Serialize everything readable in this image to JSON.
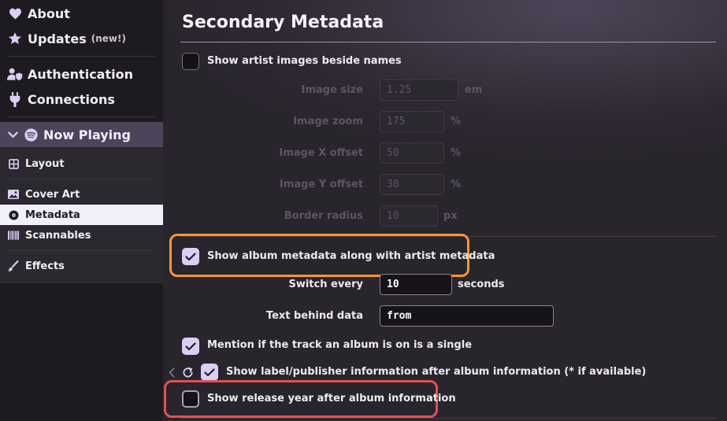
{
  "sidebar": {
    "about": "About",
    "updates": "Updates",
    "updates_badge": "(new!)",
    "authentication": "Authentication",
    "connections": "Connections",
    "now_playing": "Now Playing",
    "layout": "Layout",
    "cover_art": "Cover Art",
    "metadata": "Metadata",
    "scannables": "Scannables",
    "effects": "Effects",
    "selected": "Metadata"
  },
  "section": {
    "title": "Secondary Metadata"
  },
  "options": {
    "show_artist_images": {
      "label": "Show artist images beside names",
      "checked": false
    },
    "image_size": {
      "label": "Image size",
      "value": "1.25",
      "unit": "em"
    },
    "image_zoom": {
      "label": "Image zoom",
      "value": "175",
      "unit": "%"
    },
    "image_x_offset": {
      "label": "Image X offset",
      "value": "50",
      "unit": "%"
    },
    "image_y_offset": {
      "label": "Image Y offset",
      "value": "30",
      "unit": "%"
    },
    "border_radius": {
      "label": "Border radius",
      "value": "10",
      "unit": "px"
    },
    "show_album_metadata": {
      "label": "Show album metadata along with artist metadata",
      "checked": true
    },
    "switch_every": {
      "label": "Switch every",
      "value": "10",
      "unit": "seconds"
    },
    "text_behind_data": {
      "label": "Text behind data",
      "value": "from"
    },
    "mention_single": {
      "label": "Mention if the track an album is on is a single",
      "checked": true
    },
    "show_label_publisher": {
      "label": "Show label/publisher information after album information (* if available)",
      "checked": true
    },
    "show_release_year": {
      "label": "Show release year after album information",
      "checked": false
    }
  },
  "colors": {
    "highlight_orange": "#f39a28",
    "highlight_red": "#e6504e",
    "checkbox_checked": "#d9cff3",
    "accent": "#4c445a"
  },
  "icons": {
    "about": "heart-icon",
    "updates": "star-icon",
    "authentication": "user-shield-icon",
    "connections": "plug-icon",
    "now_playing": "spotify-icon",
    "layout": "grid-icon",
    "cover_art": "image-icon",
    "metadata": "record-icon",
    "scannables": "barcode-icon",
    "effects": "brush-icon"
  }
}
